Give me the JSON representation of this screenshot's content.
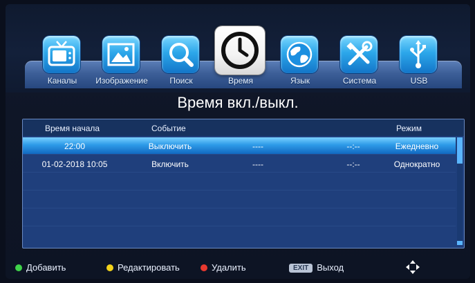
{
  "menu": {
    "items": [
      {
        "label": "Каналы",
        "icon": "tv-icon"
      },
      {
        "label": "Изображение",
        "icon": "picture-icon"
      },
      {
        "label": "Поиск",
        "icon": "search-icon"
      },
      {
        "label": "Время",
        "icon": "clock-icon",
        "active": true
      },
      {
        "label": "Язык",
        "icon": "globe-icon"
      },
      {
        "label": "Система",
        "icon": "tools-icon"
      },
      {
        "label": "USB",
        "icon": "usb-icon"
      }
    ]
  },
  "page": {
    "title": "Время вкл./выкл."
  },
  "table": {
    "headers": {
      "start_time": "Время начала",
      "event": "Событие",
      "mode": "Режим"
    },
    "rows": [
      {
        "start_time": "22:00",
        "event": "Выключить",
        "col3": "----",
        "col4": "--:--",
        "mode": "Ежедневно",
        "selected": true
      },
      {
        "start_time": "01-02-2018 10:05",
        "event": "Включить",
        "col3": "----",
        "col4": "--:--",
        "mode": "Однократно",
        "selected": false
      }
    ],
    "empty_rows": 4
  },
  "footer": {
    "add": "Добавить",
    "edit": "Редактировать",
    "delete": "Удалить",
    "exit_key": "EXIT",
    "exit": "Выход",
    "colors": {
      "green": "#3fd24a",
      "yellow": "#f2d21a",
      "red": "#e8392f"
    }
  }
}
